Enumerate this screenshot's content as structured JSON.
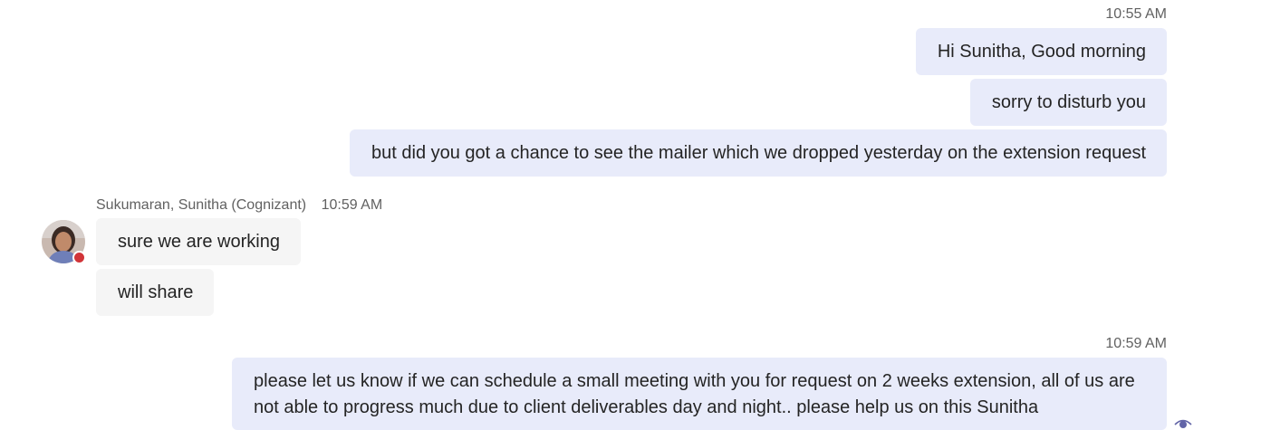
{
  "messages": {
    "first_time": "10:55 AM",
    "outgoing_1": [
      "Hi Sunitha, Good morning",
      "sorry to disturb you",
      "but did you got a chance to see the mailer which we dropped yesterday on the extension request"
    ],
    "incoming_sender": "Sukumaran, Sunitha (Cognizant)",
    "incoming_time": "10:59 AM",
    "incoming": [
      "sure we are working",
      "will share"
    ],
    "second_time": "10:59 AM",
    "outgoing_2": "please let us know if we can schedule a small meeting with you for request on 2 weeks extension, all of us are not able to progress much due to client deliverables day and night.. please help us on this Sunitha"
  },
  "status": {
    "presence": "busy",
    "presence_color": "#d13438",
    "read_icon": "eye-icon"
  },
  "colors": {
    "outgoing_bubble": "#e8ebfa",
    "incoming_bubble": "#f5f5f5",
    "accent": "#6264a7"
  }
}
